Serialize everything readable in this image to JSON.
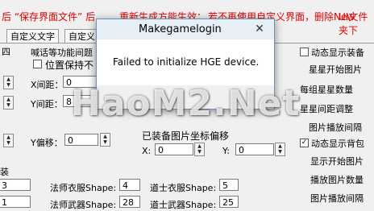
{
  "notice": {
    "part1": "后 “保存界面文件” 后",
    "part2": "重新生成方能生效；",
    "part3": "若不再使用自定义界面，删除New",
    "part4": "UI文件夹下"
  },
  "tabs": [
    {
      "label": "自定义文字"
    },
    {
      "label": "自定义"
    }
  ],
  "left_panel": {
    "top_label": "四",
    "shout_label": "喊话等功能间题",
    "keep_position_label": "位置保持不",
    "x_spacing_label": "X间距：",
    "x_spacing_value": "0",
    "y_spacing_label": "Y间距：",
    "y_spacing_value": "8",
    "y_offset_label": "Y偏移：",
    "y_offset_value": "0",
    "equip_label": "装",
    "mage_cloth_label": "法师衣服Shape:",
    "mage_cloth_value": "4",
    "mage_weapon_label": "法师武器Shape:",
    "mage_weapon_value": "28",
    "left_row1_value": "3",
    "left_row2_value": "1"
  },
  "equip_offset": {
    "label": "已装备图片坐标偏移",
    "x_label": "X:",
    "x_value": "0",
    "y_label": "Y:",
    "y_value": "0"
  },
  "taoist": {
    "cloth_label": "道士衣服Shape:",
    "cloth_value": "5",
    "weapon_label": "道士武器Shape:",
    "weapon_value": "25"
  },
  "right_panel": {
    "anim_equip_label": "动态显示装备",
    "star_start_label": "星星开始图片",
    "star_count_label": "每组星星数量",
    "star_spacing_label": "星星间距调整",
    "image_interval_label": "图片播放间隔",
    "anim_bg_label": "动态显示背包",
    "show_start_label": "显示开始图片",
    "play_count_label": "播放图片数量",
    "play_interval_label": "图片播放间隔"
  },
  "dialog": {
    "title": "Makegamelogin",
    "close_glyph": "✕",
    "message": "Failed to initialize HGE device."
  },
  "watermark": "HaoM2.Net"
}
